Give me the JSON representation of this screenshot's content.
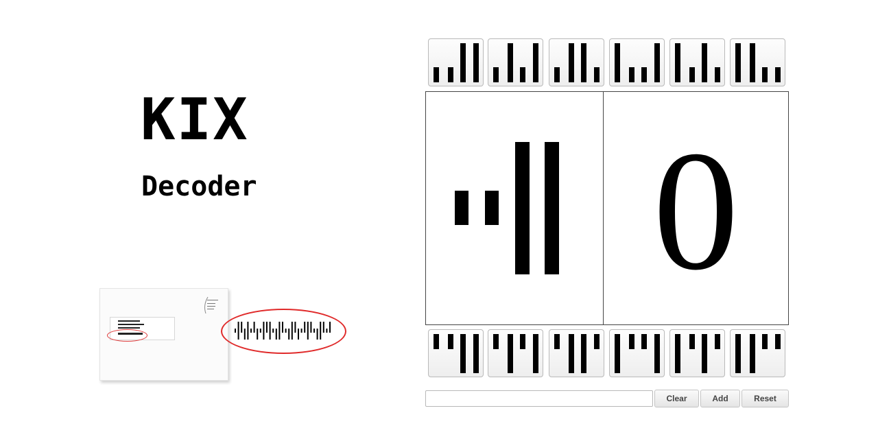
{
  "app": {
    "title": "KIX",
    "subtitle": "Decoder"
  },
  "colors": {
    "highlight_oval": "#e02a2a",
    "bar": "#000000",
    "key_background": "#f3f3f3"
  },
  "icons": {
    "top_keys": [
      "kix-symbol-top-1-icon",
      "kix-symbol-top-2-icon",
      "kix-symbol-top-3-icon",
      "kix-symbol-top-4-icon",
      "kix-symbol-top-5-icon",
      "kix-symbol-top-6-icon"
    ],
    "bottom_keys": [
      "kix-symbol-bottom-1-icon",
      "kix-symbol-bottom-2-icon",
      "kix-symbol-bottom-3-icon",
      "kix-symbol-bottom-4-icon",
      "kix-symbol-bottom-5-icon",
      "kix-symbol-bottom-6-icon"
    ]
  },
  "display": {
    "decoded_character": "0"
  },
  "controls": {
    "input_value": "",
    "input_placeholder": "",
    "clear_label": "Clear",
    "add_label": "Add",
    "reset_label": "Reset"
  }
}
